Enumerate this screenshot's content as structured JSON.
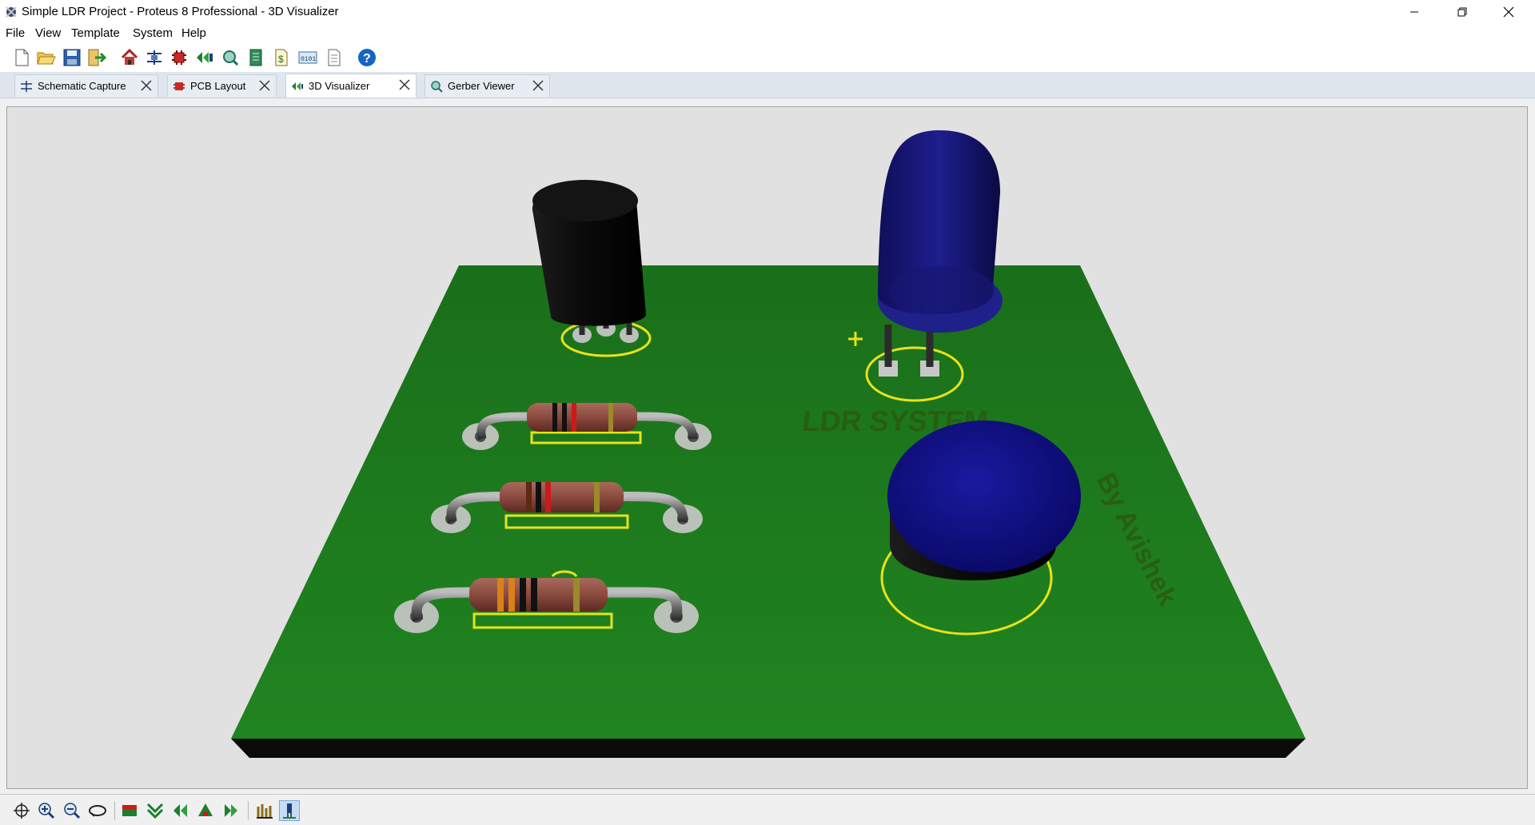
{
  "window": {
    "title": "Simple LDR Project - Proteus 8 Professional - 3D Visualizer",
    "controls": [
      "minimize",
      "restore",
      "close"
    ]
  },
  "menu": {
    "items": [
      {
        "label": "File"
      },
      {
        "label": "View"
      },
      {
        "label": "Template"
      },
      {
        "label": "System"
      },
      {
        "label": "Help"
      }
    ]
  },
  "toolbar": {
    "buttons": [
      "new-file-icon",
      "open-folder-icon",
      "save-icon",
      "import-icon",
      "home-icon",
      "schematic-icon",
      "pcb-icon",
      "3d-visualizer-icon",
      "gerber-icon",
      "bom-icon",
      "design-explorer-icon",
      "simulation-log-icon",
      "notes-icon",
      "help-icon"
    ]
  },
  "tabs": [
    {
      "label": "Schematic Capture",
      "icon": "schematic-icon",
      "active": false
    },
    {
      "label": "PCB Layout",
      "icon": "pcb-icon",
      "active": false
    },
    {
      "label": "3D Visualizer",
      "icon": "3d-visualizer-icon",
      "active": true
    },
    {
      "label": "Gerber Viewer",
      "icon": "gerber-icon",
      "active": false
    }
  ],
  "board": {
    "silkscreen_title": "LDR SYSTEM",
    "silkscreen_author": "By Avishek",
    "colors": {
      "board_top": "#1c7a1c",
      "board_edge": "#0b0b0b",
      "silkscreen": "#e8e21a",
      "led_body": "#1a1a7a",
      "transistor_body": "#0e0e0e",
      "resistor_body": "#8b4a3e",
      "viewport_bg": "#e1e1e1"
    },
    "components": [
      "transistor",
      "led",
      "resistor-1",
      "resistor-2",
      "resistor-3",
      "ldr"
    ]
  },
  "bottom_toolbar": {
    "buttons": [
      "pan-icon",
      "zoom-in-icon",
      "zoom-out-icon",
      "orbit-icon",
      "top-view-icon",
      "front-view-icon",
      "left-view-icon",
      "back-view-icon",
      "right-view-icon",
      "height-view-icon",
      "show-components-icon"
    ],
    "pressed": "show-components-icon"
  }
}
